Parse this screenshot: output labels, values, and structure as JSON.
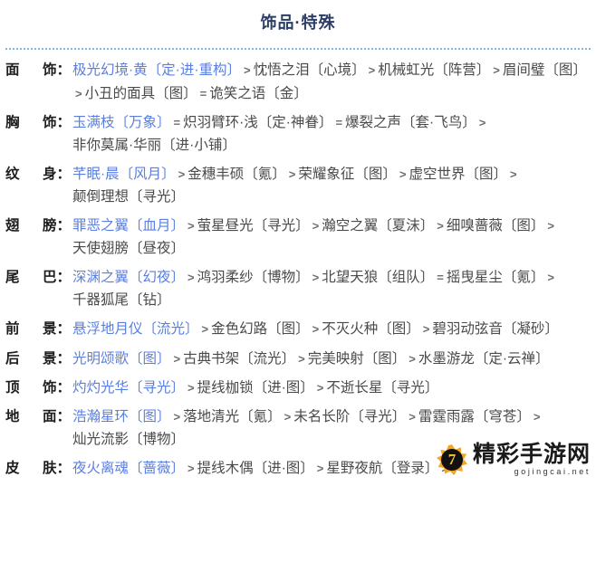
{
  "header": {
    "title": "饰品·特殊"
  },
  "rows": [
    {
      "slot_char1": "面",
      "slot_char2": "饰",
      "colon": "：",
      "entries": [
        {
          "text": "极光幻境·黄〔定·进·重构〕",
          "sep": ""
        },
        {
          "text": "忱悟之泪〔心境〕",
          "sep": ">"
        },
        {
          "text": "机械虹光〔阵营〕",
          "sep": ">"
        },
        {
          "text": "眉间璧〔图〕",
          "sep": ">"
        },
        {
          "text": "小丑的面具〔图〕",
          "sep": ">"
        },
        {
          "text": "诡笑之语〔金〕",
          "sep": "="
        }
      ]
    },
    {
      "slot_char1": "胸",
      "slot_char2": "饰",
      "colon": "：",
      "entries": [
        {
          "text": "玉满枝〔万象〕",
          "sep": ""
        },
        {
          "text": "炽羽臂环·浅〔定·神眷〕",
          "sep": "="
        },
        {
          "text": "爆裂之声〔套·飞鸟〕",
          "sep": "="
        },
        {
          "text": "非你莫属·华丽〔进·小铺〕",
          "sep": ">"
        }
      ]
    },
    {
      "slot_char1": "纹",
      "slot_char2": "身",
      "colon": "：",
      "entries": [
        {
          "text": "芊眠·晨〔风月〕",
          "sep": ""
        },
        {
          "text": "金穗丰硕〔氪〕",
          "sep": ">"
        },
        {
          "text": "荣耀象征〔图〕",
          "sep": ">"
        },
        {
          "text": "虚空世界〔图〕",
          "sep": ">"
        },
        {
          "text": "颠倒理想〔寻光〕",
          "sep": ">"
        }
      ]
    },
    {
      "slot_char1": "翅",
      "slot_char2": "膀",
      "colon": "：",
      "entries": [
        {
          "text": "罪恶之翼〔血月〕",
          "sep": ""
        },
        {
          "text": "萤星昼光〔寻光〕",
          "sep": ">"
        },
        {
          "text": "瀚空之翼〔夏沫〕",
          "sep": ">"
        },
        {
          "text": "细嗅蔷薇〔图〕",
          "sep": ">"
        },
        {
          "text": "天使翅膀〔昼夜〕",
          "sep": ">"
        }
      ]
    },
    {
      "slot_char1": "尾",
      "slot_char2": "巴",
      "colon": "：",
      "entries": [
        {
          "text": "深渊之翼〔幻夜〕",
          "sep": ""
        },
        {
          "text": "鸿羽柔纱〔博物〕",
          "sep": ">"
        },
        {
          "text": "北望天狼〔组队〕",
          "sep": ">"
        },
        {
          "text": "摇曳星尘〔氪〕",
          "sep": "="
        },
        {
          "text": "千器狐尾〔钻〕",
          "sep": ">"
        }
      ]
    },
    {
      "slot_char1": "前",
      "slot_char2": "景",
      "colon": "：",
      "entries": [
        {
          "text": "悬浮地月仪〔流光〕",
          "sep": ""
        },
        {
          "text": "金色幻路〔图〕",
          "sep": ">"
        },
        {
          "text": "不灭火种〔图〕",
          "sep": ">"
        },
        {
          "text": "碧羽动弦音〔凝砂〕",
          "sep": ">"
        }
      ]
    },
    {
      "slot_char1": "后",
      "slot_char2": "景",
      "colon": "：",
      "entries": [
        {
          "text": "光明颂歌〔图〕",
          "sep": ""
        },
        {
          "text": "古典书架〔流光〕",
          "sep": ">"
        },
        {
          "text": "完美映射〔图〕",
          "sep": ">"
        },
        {
          "text": "水墨游龙〔定·云禅〕",
          "sep": ">"
        }
      ]
    },
    {
      "slot_char1": "顶",
      "slot_char2": "饰",
      "colon": "：",
      "entries": [
        {
          "text": "灼灼光华〔寻光〕",
          "sep": ""
        },
        {
          "text": "提线枷锁〔进·图〕",
          "sep": ">"
        },
        {
          "text": "不逝长星〔寻光〕",
          "sep": ">"
        }
      ]
    },
    {
      "slot_char1": "地",
      "slot_char2": "面",
      "colon": "：",
      "entries": [
        {
          "text": "浩瀚星环〔图〕",
          "sep": ""
        },
        {
          "text": "落地清光〔氪〕",
          "sep": ">"
        },
        {
          "text": "未名长阶〔寻光〕",
          "sep": ">"
        },
        {
          "text": "雷霆雨露〔穹苍〕",
          "sep": ">"
        },
        {
          "text": "灿光流影〔博物〕",
          "sep": ">"
        }
      ]
    },
    {
      "slot_char1": "皮",
      "slot_char2": "肤",
      "colon": "：",
      "entries": [
        {
          "text": "夜火离魂〔蔷薇〕",
          "sep": ""
        },
        {
          "text": "提线木偶〔进·图〕",
          "sep": ">"
        },
        {
          "text": "星野夜航〔登录〕",
          "sep": ">"
        },
        {
          "text": "",
          "sep": ">"
        }
      ]
    }
  ],
  "watermark": {
    "glyph": "7",
    "main_text": "精彩手游网",
    "sub_text": "gojingcai.net"
  },
  "colors": {
    "title": "#2c3e66",
    "divider": "#7fb6e8",
    "first_item": "#5b7fe0",
    "other_items": "#4a4a4a",
    "slot_label": "#1d1d1d",
    "watermark_badge": "#f5a623"
  }
}
